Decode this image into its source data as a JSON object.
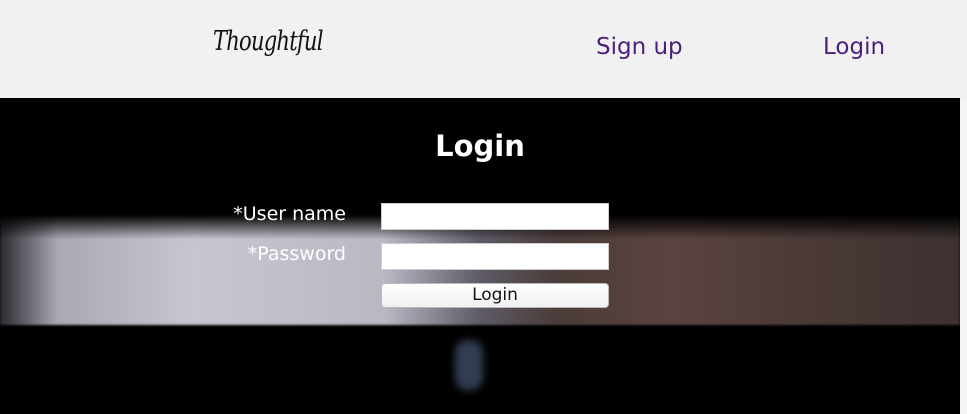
{
  "header": {
    "logo_text": "Thoughtful",
    "nav": {
      "signup_label": "Sign up",
      "login_label": "Login"
    },
    "link_color": "#4b1f7a"
  },
  "login_form": {
    "title": "Login",
    "username_label": "*User name",
    "password_label": "*Password",
    "username_value": "",
    "password_value": "",
    "submit_label": "Login"
  }
}
